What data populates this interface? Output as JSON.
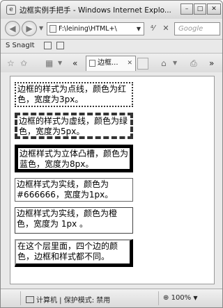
{
  "window": {
    "title": "边框实例手把手 - Windows Internet Explo...",
    "minimize_glyph": "–",
    "maximize_glyph": "□",
    "close_glyph": "✕"
  },
  "address_bar": {
    "url": "F:\\leining\\HTML+\\",
    "search_placeholder": "Google",
    "back_glyph": "◀",
    "forward_glyph": "▶",
    "refresh_glyph": "⁴⁄",
    "stop_glyph": "✕"
  },
  "links_bar": {
    "snagit_label": "SnagIt"
  },
  "tab_bar": {
    "tab_label": "边框...",
    "favorites_glyph": "☆",
    "add_favorites_glyph": "✩",
    "chevron_glyph": "«",
    "home_glyph": "⌂",
    "more_glyph": "»"
  },
  "content": {
    "boxes": [
      "边框的样式为点线，颜色为红色，宽度为3px。",
      "边框的样式为虚线，颜色为绿色，宽度为5px。",
      "边框样式为立体凸槽，颜色为蓝色，宽度为8px。",
      "边框样式为实线，颜色为#666666，宽度为1px。",
      "边框样式为实线，颜色为橙色，宽度为 1px 。",
      "在这个层里面，四个边的颜色，边框和样式都不同。"
    ]
  },
  "status_bar": {
    "zone_text": "计算机 | 保护模式: 禁用",
    "zoom_text": "100%"
  }
}
